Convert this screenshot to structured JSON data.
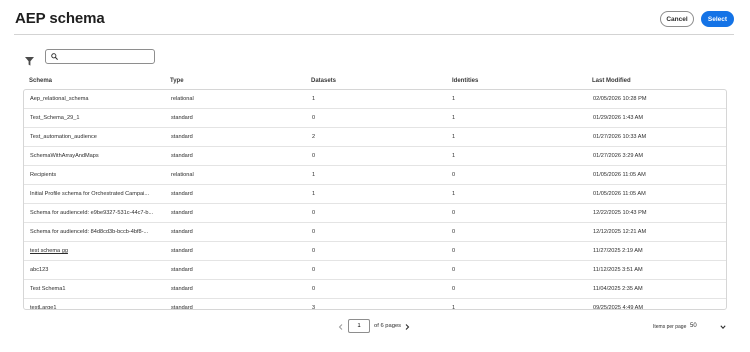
{
  "header": {
    "title": "AEP schema",
    "cancel_label": "Cancel",
    "select_label": "Select"
  },
  "toolbar": {
    "filter_icon": "filter-icon",
    "search_icon": "search-icon",
    "search_value": "",
    "search_placeholder": ""
  },
  "table": {
    "columns": [
      "Schema",
      "Type",
      "Datasets",
      "Identities",
      "Last Modified"
    ],
    "rows": [
      {
        "schema": "Aep_relational_schema",
        "type": "relational",
        "datasets": "1",
        "identities": "1",
        "modified": "02/05/2026 10:28 PM",
        "underline": false
      },
      {
        "schema": "Test_Schema_29_1",
        "type": "standard",
        "datasets": "0",
        "identities": "1",
        "modified": "01/29/2026 1:43 AM",
        "underline": false
      },
      {
        "schema": "Test_automation_audience",
        "type": "standard",
        "datasets": "2",
        "identities": "1",
        "modified": "01/27/2026 10:33 AM",
        "underline": false
      },
      {
        "schema": "SchemaWithArrayAndMaps",
        "type": "standard",
        "datasets": "0",
        "identities": "1",
        "modified": "01/27/2026 3:29 AM",
        "underline": false
      },
      {
        "schema": "Recipients",
        "type": "relational",
        "datasets": "1",
        "identities": "0",
        "modified": "01/05/2026 11:05 AM",
        "underline": false
      },
      {
        "schema": "Initial Profile schema for Orchestrated Campai...",
        "type": "standard",
        "datasets": "1",
        "identities": "1",
        "modified": "01/05/2026 11:05 AM",
        "underline": false
      },
      {
        "schema": "Schema for audienceId: e9be9327-531c-44c7-b...",
        "type": "standard",
        "datasets": "0",
        "identities": "0",
        "modified": "12/22/2025 10:43 PM",
        "underline": false
      },
      {
        "schema": "Schema for audienceId: 84d8cd3b-bccb-4bf8-...",
        "type": "standard",
        "datasets": "0",
        "identities": "0",
        "modified": "12/12/2025 12:21 AM",
        "underline": false
      },
      {
        "schema": "test schema gg",
        "type": "standard",
        "datasets": "0",
        "identities": "0",
        "modified": "11/27/2025 2:19 AM",
        "underline": true
      },
      {
        "schema": "abc123",
        "type": "standard",
        "datasets": "0",
        "identities": "0",
        "modified": "11/12/2025 3:51 AM",
        "underline": false
      },
      {
        "schema": "Test Schema1",
        "type": "standard",
        "datasets": "0",
        "identities": "0",
        "modified": "11/04/2025 2:35 AM",
        "underline": false
      },
      {
        "schema": "testLarge1",
        "type": "standard",
        "datasets": "3",
        "identities": "1",
        "modified": "09/25/2025 4:49 AM",
        "underline": false
      }
    ]
  },
  "pagination": {
    "current_page": "1",
    "of_pages_label": "of 6 pages",
    "items_per_page_label": "Items per page",
    "items_per_page_value": "50",
    "prev_icon": "chevron-left-icon",
    "next_icon": "chevron-right-icon",
    "dropdown_icon": "chevron-down-icon"
  },
  "colors": {
    "accent": "#1473e6",
    "border": "#d6d6d6"
  }
}
